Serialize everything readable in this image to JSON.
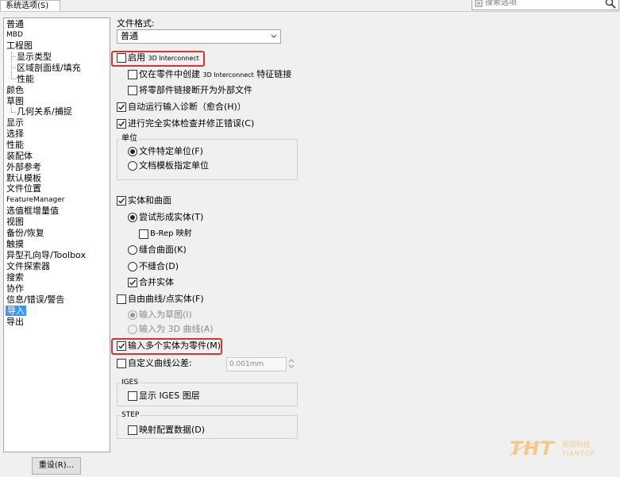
{
  "tab": {
    "label": "系统选项(S)"
  },
  "search": {
    "placeholder": "搜索选项"
  },
  "tree": {
    "items": [
      "普通",
      "MBD",
      "工程图",
      "显示类型",
      "区域剖面线/填充",
      "性能",
      "颜色",
      "草图",
      "几何关系/捕捉",
      "显示",
      "选择",
      "性能",
      "装配体",
      "外部参考",
      "默认模板",
      "文件位置",
      "FeatureManager",
      "选值框增量值",
      "视图",
      "备份/恢复",
      "触摸",
      "异型孔向导/Toolbox",
      "文件探索器",
      "搜索",
      "协作",
      "信息/错误/警告",
      "导入",
      "导出"
    ]
  },
  "reset_button": "重设(R)...",
  "file_format": {
    "label": "文件格式:",
    "value": "普通"
  },
  "options": {
    "enable_3d_interconnect": {
      "prefix": "启用",
      "suffix": "3D Interconnect"
    },
    "only_in_part": {
      "a": "仅在零件中创建",
      "b": "3D Interconnect",
      "c": "特征链接"
    },
    "break_link": "将零部件链接断开为外部文件",
    "auto_diag": "自动运行输入诊断（愈合(H)）",
    "full_check": "进行完全实体检查并修正错误(C)",
    "units_group": "单位",
    "unit_file": "文件特定单位(F)",
    "unit_template": "文档模板指定单位",
    "solids_surfaces": "实体和曲面",
    "try_solid": "尝试形成实体(T)",
    "brep_map": "B-Rep 映射",
    "knit_surface": "缝合曲面(K)",
    "no_knit": "不缝合(D)",
    "merge_solid": "合并实体",
    "free_curves": "自由曲线/点实体(F)",
    "as_sketch": "输入为草图(I)",
    "as_3d_curve": "输入为 3D 曲线(A)",
    "multi_body_as_parts": "输入多个实体为零件(M)",
    "custom_tolerance": "自定义曲线公差:",
    "tolerance_value": "0.001mm",
    "iges_group": "IGES",
    "show_iges_layers": "显示 IGES 图层",
    "step_group": "STEP",
    "map_config_data": "映射配置数据(D)"
  },
  "watermark": {
    "brand": "THT",
    "cn": "拓恒科技",
    "en": "TIANTOP"
  }
}
